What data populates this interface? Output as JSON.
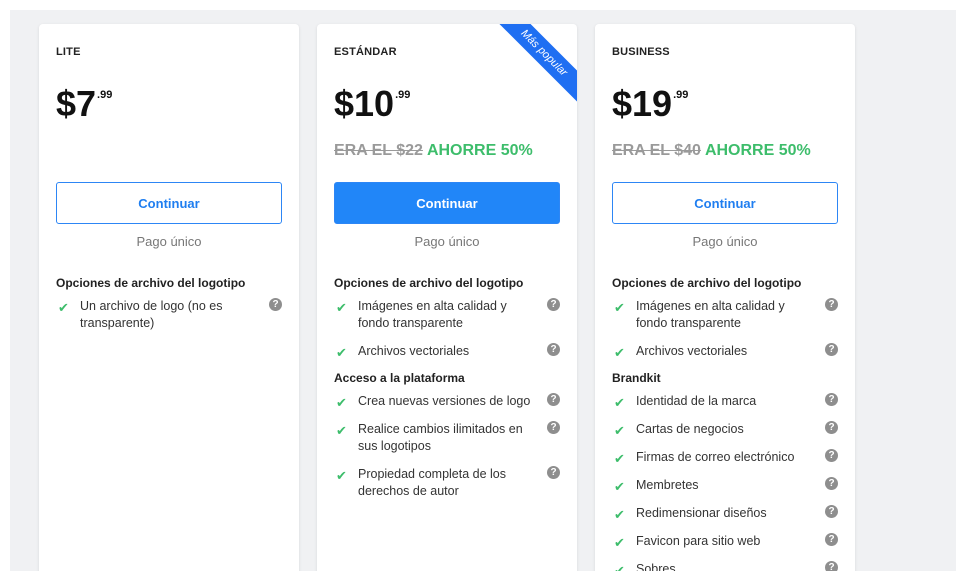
{
  "ribbon": "Más popular",
  "plans": [
    {
      "name": "LITE",
      "price_main": "$7",
      "price_cents": ".99",
      "button": "Continuar",
      "payment": "Pago único",
      "sections": [
        {
          "title": "Opciones de archivo del logotipo",
          "items": [
            "Un archivo de logo (no es transparente)"
          ]
        }
      ]
    },
    {
      "name": "ESTÁNDAR",
      "price_main": "$10",
      "price_cents": ".99",
      "old_price": "ERA EL $22",
      "savings": "AHORRE 50%",
      "button": "Continuar",
      "payment": "Pago único",
      "sections": [
        {
          "title": "Opciones de archivo del logotipo",
          "items": [
            "Imágenes en alta calidad y fondo transparente",
            "Archivos vectoriales"
          ]
        },
        {
          "title": "Acceso a la plataforma",
          "items": [
            "Crea nuevas versiones de logo",
            "Realice cambios ilimitados en sus logotipos",
            "Propiedad completa de los derechos de autor"
          ]
        }
      ]
    },
    {
      "name": "BUSINESS",
      "price_main": "$19",
      "price_cents": ".99",
      "old_price": "ERA EL $40",
      "savings": "AHORRE 50%",
      "button": "Continuar",
      "payment": "Pago único",
      "sections": [
        {
          "title": "Opciones de archivo del logotipo",
          "items": [
            "Imágenes en alta calidad y fondo transparente",
            "Archivos vectoriales"
          ]
        },
        {
          "title": "Brandkit",
          "items": [
            "Identidad de la marca",
            "Cartas de negocios",
            "Firmas de correo electrónico",
            "Membretes",
            "Redimensionar diseños",
            "Favicon para sitio web",
            "Sobres"
          ]
        }
      ]
    }
  ],
  "icons": {
    "check": "check-icon",
    "help": "help-icon"
  },
  "colors": {
    "accent": "#2186f8",
    "savings": "#3dbd6b",
    "ribbon": "#1f6ff2"
  }
}
